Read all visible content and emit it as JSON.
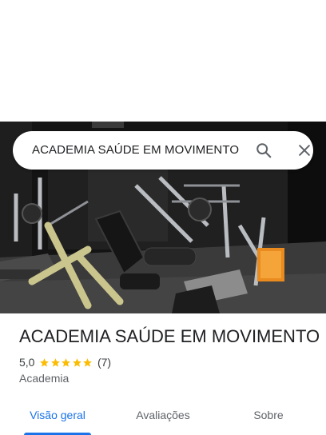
{
  "search": {
    "query": "ACADEMIA SAÚDE EM MOVIMENTO",
    "search_icon": "search-icon",
    "close_icon": "close-icon"
  },
  "place": {
    "title": "ACADEMIA SAÚDE EM MOVIMENTO",
    "rating": "5,0",
    "stars": 5,
    "review_count": "(7)",
    "category": "Academia",
    "photo_description_icon": "gym-photo"
  },
  "tabs": [
    {
      "label": "Visão geral",
      "active": true
    },
    {
      "label": "Avaliações",
      "active": false
    },
    {
      "label": "Sobre",
      "active": false
    }
  ],
  "colors": {
    "accent": "#1a73e8",
    "star": "#fbbc04",
    "text": "#202124",
    "muted": "#5f6368"
  }
}
